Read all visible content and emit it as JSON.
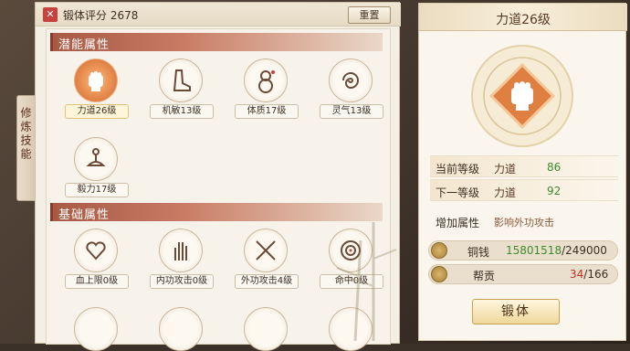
{
  "header": {
    "score_label": "锻体评分",
    "score_value": "2678",
    "reset_label": "重置"
  },
  "side_tab": {
    "label": "修炼技能"
  },
  "potential": {
    "title": "潜能属性",
    "skills": [
      {
        "label": "力道26级",
        "icon": "fist-icon"
      },
      {
        "label": "机敏13级",
        "icon": "boot-icon"
      },
      {
        "label": "体质17级",
        "icon": "gourd-icon"
      },
      {
        "label": "灵气13级",
        "icon": "swirl-icon"
      },
      {
        "label": "毅力17级",
        "icon": "meditation-icon"
      }
    ]
  },
  "basic": {
    "title": "基础属性",
    "skills": [
      {
        "label": "血上限0级",
        "icon": "heart-hand-icon"
      },
      {
        "label": "内功攻击0级",
        "icon": "palm-icon"
      },
      {
        "label": "外功攻击4级",
        "icon": "swords-icon"
      },
      {
        "label": "命中0级",
        "icon": "target-icon"
      }
    ]
  },
  "detail": {
    "title": "力道26级",
    "current_label": "当前等级",
    "current_name": "力道",
    "current_value": "86",
    "next_label": "下一等级",
    "next_name": "力道",
    "next_value": "92",
    "bonus_label": "增加属性",
    "bonus_desc": "影响外功攻击",
    "copper_label": "铜钱",
    "copper_have": "15801518",
    "copper_need": "249000",
    "contrib_label": "帮贡",
    "contrib_have": "34",
    "contrib_need": "166",
    "forge_label": "锻体"
  },
  "colors": {
    "green": "#3e8a2e",
    "red": "#c8302a",
    "accent": "#e07f42"
  }
}
